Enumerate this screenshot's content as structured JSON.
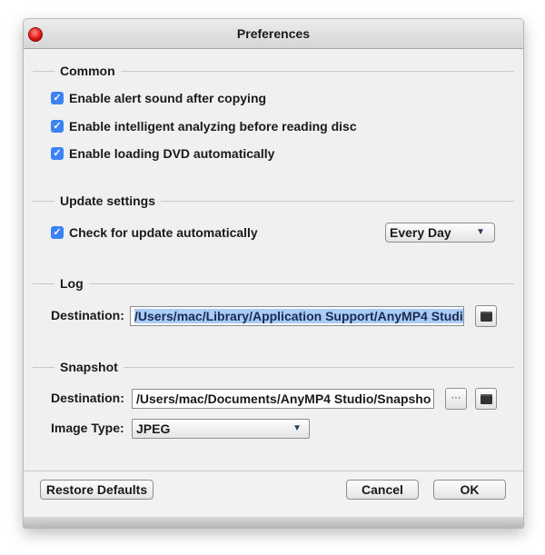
{
  "window": {
    "title": "Preferences"
  },
  "common": {
    "title": "Common",
    "options": [
      {
        "label": "Enable alert sound after copying",
        "checked": true
      },
      {
        "label": "Enable intelligent analyzing before reading disc",
        "checked": true
      },
      {
        "label": "Enable loading DVD automatically",
        "checked": true
      }
    ]
  },
  "update": {
    "title": "Update settings",
    "check_label": "Check for update automatically",
    "checked": true,
    "frequency": "Every Day"
  },
  "log": {
    "title": "Log",
    "destination_label": "Destination:",
    "destination": "/Users/mac/Library/Application Support/AnyMP4 Studi"
  },
  "snapshot": {
    "title": "Snapshot",
    "destination_label": "Destination:",
    "destination": "/Users/mac/Documents/AnyMP4 Studio/Snapsho",
    "more": "···",
    "image_type_label": "Image Type:",
    "image_type": "JPEG"
  },
  "footer": {
    "restore": "Restore Defaults",
    "cancel": "Cancel",
    "ok": "OK"
  },
  "colors": {
    "checkbox": "#3b82f6",
    "selection": "#a9cbf5"
  }
}
